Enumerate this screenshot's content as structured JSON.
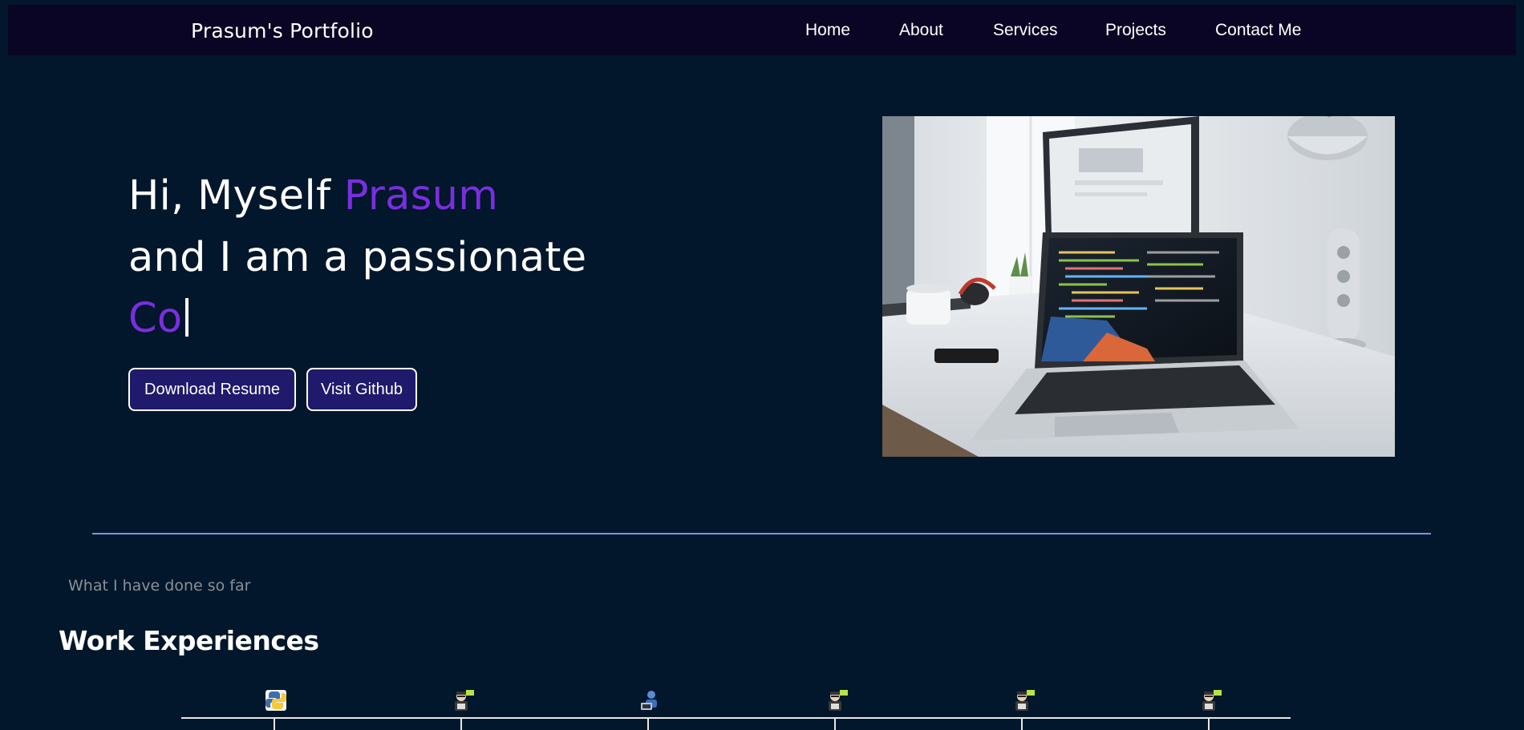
{
  "nav": {
    "brand": "Prasum's Portfolio",
    "links": [
      "Home",
      "About",
      "Services",
      "Projects",
      "Contact Me"
    ]
  },
  "hero": {
    "line1_prefix": "Hi, Myself ",
    "line1_name": "Prasum",
    "line2": "and I am a passionate",
    "typed_text": "Co",
    "buttons": {
      "resume": "Download Resume",
      "github": "Visit Github"
    },
    "image_icon": "laptop-desk-photo"
  },
  "experience": {
    "subtitle": "What I have done so far",
    "title": "Work Experiences",
    "timeline_icons": [
      "python-icon",
      "hacker-icon",
      "developer-icon",
      "hacker-icon",
      "hacker-icon",
      "hacker-icon"
    ]
  },
  "colors": {
    "background": "#02172b",
    "navbar": "#0b0525",
    "accent": "#7b2ee0",
    "button": "#1f1a6b",
    "divider": "#8f8fdb"
  }
}
